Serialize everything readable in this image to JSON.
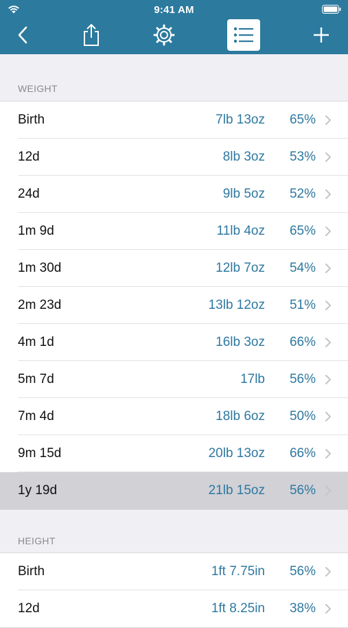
{
  "status": {
    "time": "9:41 AM"
  },
  "weight": {
    "header": "WEIGHT",
    "rows": [
      {
        "age": "Birth",
        "value": "7lb 13oz",
        "pct": "65%"
      },
      {
        "age": "12d",
        "value": "8lb 3oz",
        "pct": "53%"
      },
      {
        "age": "24d",
        "value": "9lb 5oz",
        "pct": "52%"
      },
      {
        "age": "1m 9d",
        "value": "11lb 4oz",
        "pct": "65%"
      },
      {
        "age": "1m 30d",
        "value": "12lb 7oz",
        "pct": "54%"
      },
      {
        "age": "2m 23d",
        "value": "13lb 12oz",
        "pct": "51%"
      },
      {
        "age": "4m 1d",
        "value": "16lb 3oz",
        "pct": "66%"
      },
      {
        "age": "5m 7d",
        "value": "17lb",
        "pct": "56%"
      },
      {
        "age": "7m 4d",
        "value": "18lb 6oz",
        "pct": "50%"
      },
      {
        "age": "9m 15d",
        "value": "20lb 13oz",
        "pct": "66%"
      },
      {
        "age": "1y 19d",
        "value": "21lb 15oz",
        "pct": "56%"
      }
    ]
  },
  "height": {
    "header": "HEIGHT",
    "rows": [
      {
        "age": "Birth",
        "value": "1ft 7.75in",
        "pct": "56%"
      },
      {
        "age": "12d",
        "value": "1ft 8.25in",
        "pct": "38%"
      }
    ]
  },
  "icons": {
    "back": "chevron-left-icon",
    "share": "share-icon",
    "settings": "gear-icon",
    "list": "list-icon",
    "add": "plus-icon",
    "disclosure": "chevron-right-icon"
  },
  "colors": {
    "nav": "#2c7a9e",
    "value": "#2e78a0",
    "selected_row": "#d1d1d6",
    "background": "#efeff4"
  }
}
